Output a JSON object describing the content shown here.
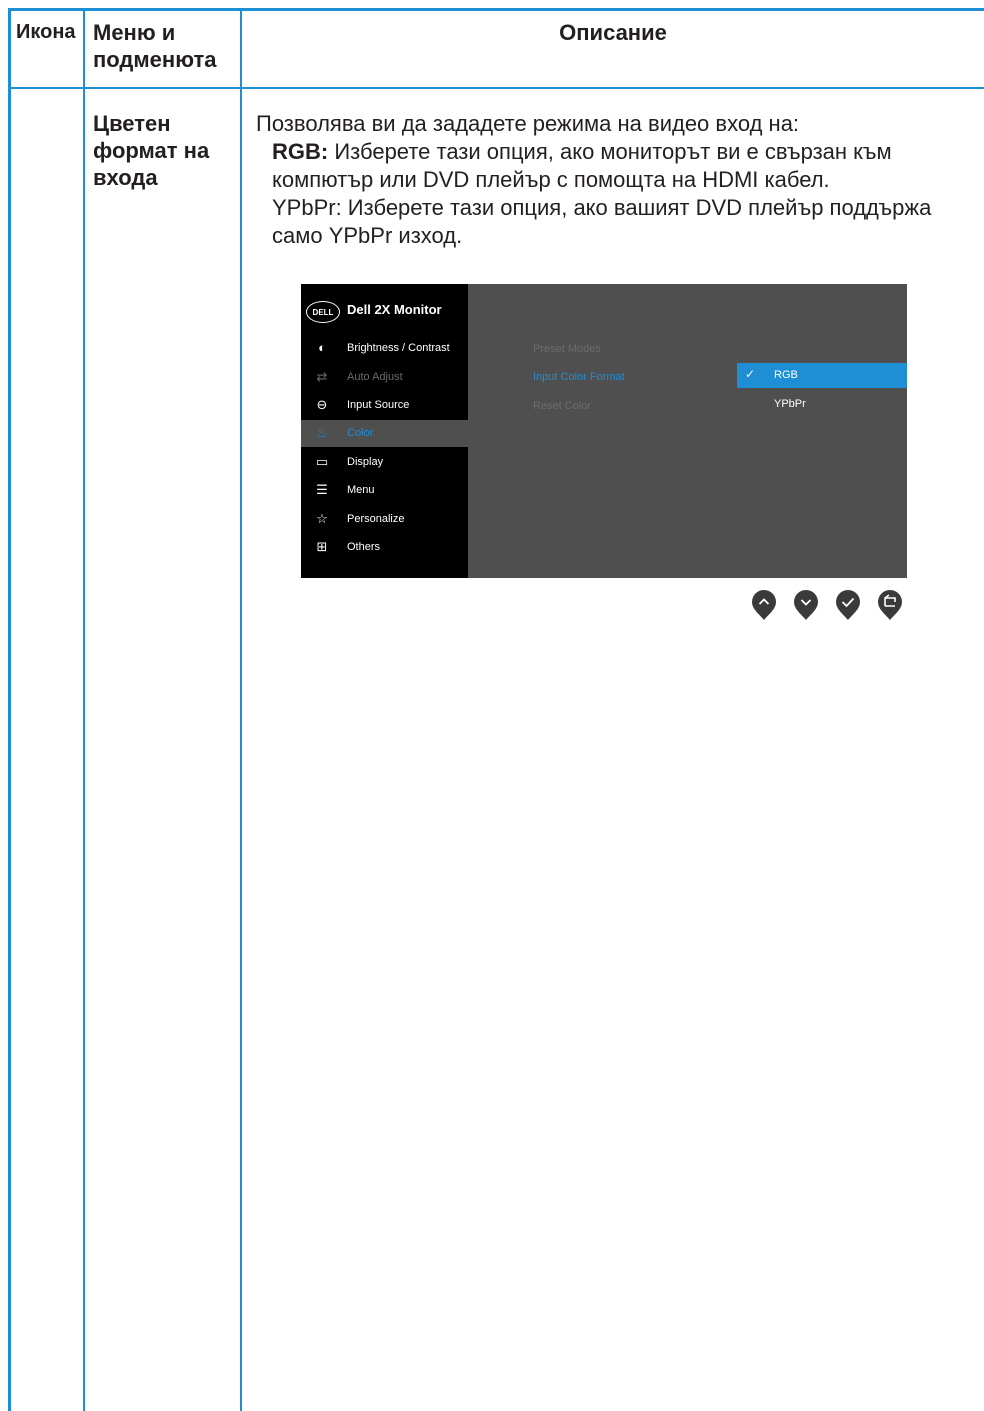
{
  "header": {
    "icon_col": "Икона",
    "menu_col_line1": "Меню и",
    "menu_col_line2": "подменюта",
    "desc_col": "Описание"
  },
  "row": {
    "menu_line1": "Цветен",
    "menu_line2": "формат на",
    "menu_line3": "входа",
    "desc_intro": "Позволява ви да зададете режима на видео вход на:",
    "rgb_label": "RGB:",
    "rgb_text": " Изберете тази опция, ако мониторът ви е свързан към компютър или DVD плейър с помощта на HDMI кабел.",
    "ypbpr_text": "YPbPr: Изберете тази опция, ако вашият DVD плейър поддържа само YPbPr изход."
  },
  "osd": {
    "logo": "DELL",
    "title": "Dell 2X Monitor",
    "items": [
      {
        "label": "Brightness / Contrast",
        "icon": "brightness-icon"
      },
      {
        "label": "Auto Adjust",
        "icon": "auto-adjust-icon"
      },
      {
        "label": "Input Source",
        "icon": "input-source-icon"
      },
      {
        "label": "Color",
        "icon": "color-icon"
      },
      {
        "label": "Display",
        "icon": "display-icon"
      },
      {
        "label": "Menu",
        "icon": "menu-icon"
      },
      {
        "label": "Personalize",
        "icon": "star-icon"
      },
      {
        "label": "Others",
        "icon": "others-icon"
      }
    ],
    "submenu": [
      "Preset Modes",
      "Input Color Format",
      "Reset Color"
    ],
    "options": [
      "RGB",
      "YPbPr"
    ],
    "selected_item": "Color",
    "selected_option": "RGB",
    "accent": "#1e8fd5"
  },
  "buttons": [
    "up-icon",
    "down-icon",
    "check-icon",
    "back-icon"
  ]
}
